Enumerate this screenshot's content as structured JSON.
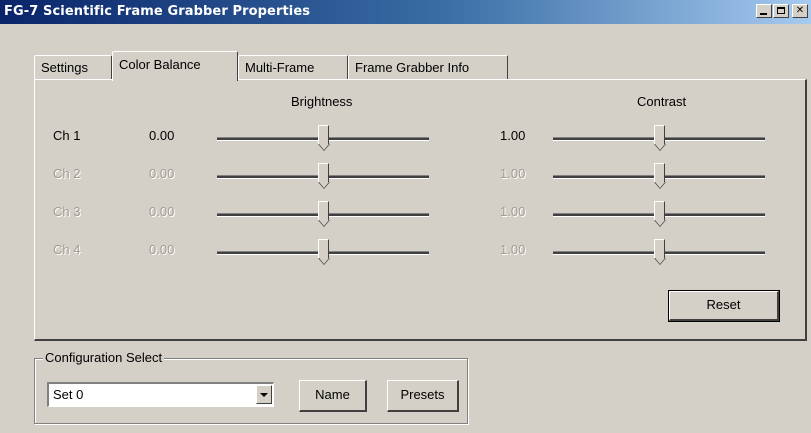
{
  "window": {
    "title": "FG-7 Scientific Frame Grabber Properties",
    "controls": [
      "minimize",
      "maximize",
      "close"
    ]
  },
  "tabs": [
    {
      "label": "Settings",
      "active": false
    },
    {
      "label": "Color Balance",
      "active": true
    },
    {
      "label": "Multi-Frame",
      "active": false
    },
    {
      "label": "Frame Grabber Info",
      "active": false
    }
  ],
  "color_balance": {
    "brightness_header": "Brightness",
    "contrast_header": "Contrast",
    "channels": [
      {
        "label": "Ch 1",
        "brightness": "0.00",
        "contrast": "1.00",
        "enabled": true,
        "brightness_level": 0.5,
        "contrast_level": 0.5
      },
      {
        "label": "Ch 2",
        "brightness": "0.00",
        "contrast": "1.00",
        "enabled": false,
        "brightness_level": 0.5,
        "contrast_level": 0.5
      },
      {
        "label": "Ch 3",
        "brightness": "0.00",
        "contrast": "1.00",
        "enabled": false,
        "brightness_level": 0.5,
        "contrast_level": 0.5
      },
      {
        "label": "Ch 4",
        "brightness": "0.00",
        "contrast": "1.00",
        "enabled": false,
        "brightness_level": 0.5,
        "contrast_level": 0.5
      }
    ],
    "reset_label": "Reset"
  },
  "configuration": {
    "group_title": "Configuration Select",
    "selected": "Set 0",
    "name_label": "Name",
    "presets_label": "Presets"
  },
  "colors": {
    "titlebar_start": "#0a246a",
    "titlebar_end": "#a6caf0",
    "face": "#d4d0c8",
    "disabled_text": "#a09c94"
  }
}
